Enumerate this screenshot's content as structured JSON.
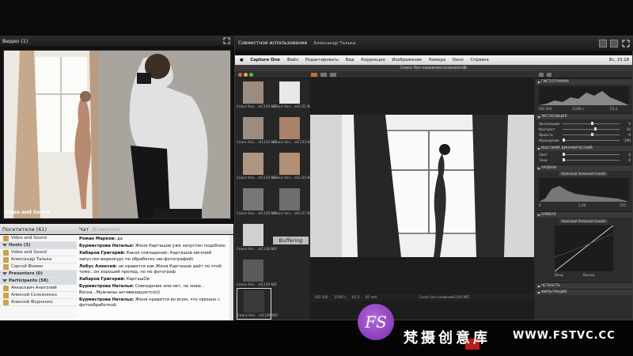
{
  "video_pod": {
    "title": "Видео (1)",
    "video_label": "Video and Sound"
  },
  "share_pod": {
    "title": "Совместное использование",
    "presenter": "Александр Талька"
  },
  "mac_menu": {
    "items": [
      "Capture One",
      "Файл",
      "Редактировать",
      "Вид",
      "Коррекция",
      "Изображение",
      "Камера",
      "Окно",
      "Справка"
    ],
    "clock": "Вс, 15:18"
  },
  "capture_one": {
    "window_title": "Сеанс без названия.cosessiondb",
    "buffering": "Buffering",
    "thumbnails": [
      "Сеанс без... at1130.NEF",
      "Сеанс без... at1131.NEF",
      "Сеанс без... at1132.NEF",
      "Сеанс без... at1133.NEF",
      "Сеанс без... at1134.NEF",
      "Сеанс без... at1135.NEF",
      "Сеанс без... at1136.NEF",
      "Сеанс без... at1137.NEF",
      "Сеанс без... at1138.NEF",
      "Сеанс без... at1139.NEF",
      "Сеанс без... at1140.NEF"
    ],
    "viewer_meta": {
      "iso": "ISO 200",
      "shutter": "1/200 s",
      "aperture": "f/3.2",
      "focal": "85 mm",
      "filename": "Сеанс без названия1140.NEF"
    },
    "panels": {
      "histogram": "ГИСТОГРАММА",
      "histogram_values": {
        "iso": "ISO 200",
        "shutter": "1/200 s",
        "aperture": "f/3.2"
      },
      "exposure": "ЭКСПОЗИЦИЯ",
      "exposure_sliders": [
        {
          "label": "Экспозиция",
          "value": "0",
          "pos": 0.5
        },
        {
          "label": "Контраст",
          "value": "10",
          "pos": 0.55
        },
        {
          "label": "Яркость",
          "value": "0",
          "pos": 0.5
        },
        {
          "label": "Насыщение",
          "value": "-100",
          "pos": 0.0
        }
      ],
      "hdr": "ВЫСОКИЙ ДИНАМИЧЕСКИЙ",
      "hdr_sliders": [
        {
          "label": "Свет",
          "value": "0",
          "pos": 0.0
        },
        {
          "label": "Тени",
          "value": "0",
          "pos": 0.0
        }
      ],
      "levels": "УРОВНИ",
      "levels_channel": "Красный Зеленый Синий",
      "levels_values": {
        "left": "0",
        "mid": "1,00",
        "right": "255"
      },
      "curve": "КРИВАЯ",
      "curve_channel": "Красный Зеленый Синий",
      "curve_labels": {
        "input": "Вход",
        "output": "Выход"
      },
      "sharpness": "ЧЕТКОСТЬ",
      "noise": "ФИЛЬТРАЦИЯ"
    }
  },
  "attendees": {
    "title": "Посетители (61)",
    "rows": [
      {
        "kind": "user",
        "name": "Video and Sound"
      },
      {
        "kind": "group",
        "name": "Hosts (3)"
      },
      {
        "kind": "user",
        "name": "Video and Sound"
      },
      {
        "kind": "user",
        "name": "Александр Талька"
      },
      {
        "kind": "user",
        "name": "Сергей Фомин"
      },
      {
        "kind": "group",
        "name": "Presenters (0)"
      },
      {
        "kind": "group",
        "name": "Participants (58)"
      },
      {
        "kind": "user",
        "name": "Аккасевич Анатолий"
      },
      {
        "kind": "user",
        "name": "Алексей Селезненко"
      },
      {
        "kind": "user",
        "name": "Алексей Федченко"
      }
    ]
  },
  "chat": {
    "title": "Чат",
    "scope": "(Everyone)",
    "messages": [
      {
        "author": "Роман Марков:",
        "text": "да"
      },
      {
        "author": "Бурмистрова Наталья:",
        "text": "Женя Карташов уже запустил подобное."
      },
      {
        "author": "Хабаров Григорий:",
        "text": "Какое совпадение: Карташов евгений запустил видеокурс по обработке  ню-фотографий)"
      },
      {
        "author": "Лобус Алексей:",
        "text": "не нравится как Женя Карташов даёт по этой теме...он хороший препод, но не фотограф"
      },
      {
        "author": "Хабаров Григорий:",
        "text": "КарташOв"
      },
      {
        "author": "Бурмистрова Наталья:",
        "text": "Совпадение или нет, не знаю... Весна...Мужчины активизируются)))"
      },
      {
        "author": "Бурмистрова Наталья:",
        "text": "Женя нравится во всем, что связано с фотообработкой."
      }
    ]
  },
  "watermark": {
    "logo": "FS",
    "cn": "梵摄创意库",
    "url": "WWW.FSTVC.CC"
  }
}
